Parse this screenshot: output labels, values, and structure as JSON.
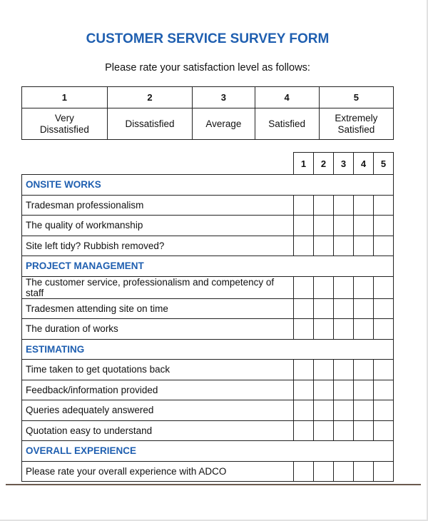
{
  "document": {
    "title": "CUSTOMER SERVICE SURVEY FORM",
    "subtitle": "Please rate your satisfaction level as follows:",
    "accent_color": "#1f5fb0"
  },
  "rating_scale": [
    {
      "value": "1",
      "label_line1": "Very",
      "label_line2": "Dissatisfied"
    },
    {
      "value": "2",
      "label_line1": "Dissatisfied",
      "label_line2": ""
    },
    {
      "value": "3",
      "label_line1": "Average",
      "label_line2": ""
    },
    {
      "value": "4",
      "label_line1": "Satisfied",
      "label_line2": ""
    },
    {
      "value": "5",
      "label_line1": "Extremely",
      "label_line2": "Satisfied"
    }
  ],
  "rating_columns": [
    "1",
    "2",
    "3",
    "4",
    "5"
  ],
  "sections": [
    {
      "title": "ONSITE WORKS",
      "items": [
        "Tradesman professionalism",
        "The quality of workmanship",
        "Site left tidy? Rubbish removed?"
      ]
    },
    {
      "title": "PROJECT MANAGEMENT",
      "items": [
        "The customer service, professionalism and competency of staff",
        "Tradesmen attending site on time",
        "The duration of works"
      ]
    },
    {
      "title": "ESTIMATING",
      "items": [
        "Time taken to get quotations back",
        "Feedback/information provided",
        "Queries adequately answered",
        "Quotation easy to understand"
      ]
    },
    {
      "title": "OVERALL EXPERIENCE",
      "items": [
        "Please rate your overall experience with ADCO"
      ]
    }
  ]
}
